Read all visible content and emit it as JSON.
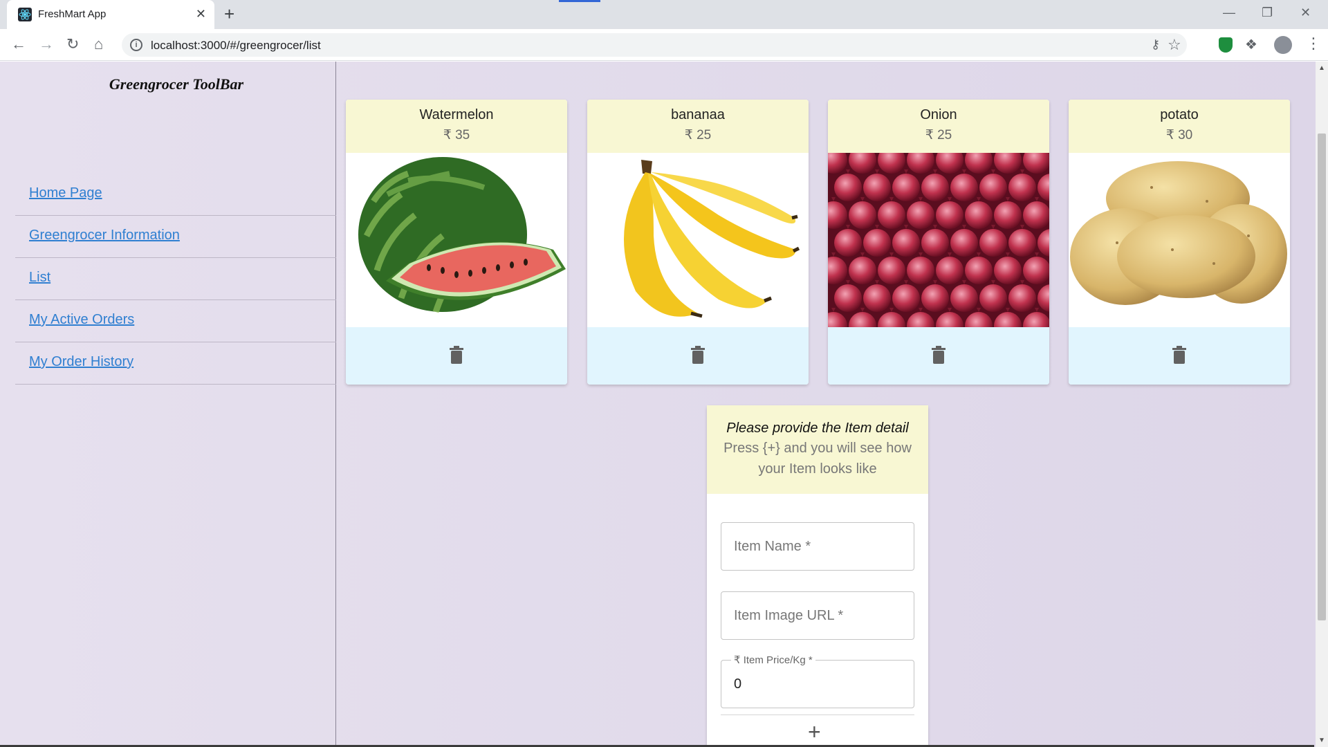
{
  "browser": {
    "tab_title": "FreshMart App",
    "tab_close": "✕",
    "new_tab": "+",
    "url": "localhost:3000/#/greengrocer/list"
  },
  "sidebar": {
    "title": "Greengrocer ToolBar",
    "items": [
      {
        "label": "Home Page"
      },
      {
        "label": "Greengrocer Information"
      },
      {
        "label": "List"
      },
      {
        "label": "My Active Orders"
      },
      {
        "label": "My Order History"
      }
    ]
  },
  "products": [
    {
      "name": "Watermelon",
      "price": "₹ 35",
      "image": "watermelon"
    },
    {
      "name": "bananaa",
      "price": "₹ 25",
      "image": "banana"
    },
    {
      "name": "Onion",
      "price": "₹ 25",
      "image": "onion"
    },
    {
      "name": "potato",
      "price": "₹ 30",
      "image": "potato"
    }
  ],
  "form": {
    "heading": "Please provide the Item detail",
    "subtext": "Press {+} and you will see how your Item looks like",
    "name_placeholder": "Item Name *",
    "image_placeholder": "Item Image URL *",
    "price_label": "₹ Item Price/Kg *",
    "price_value": "0",
    "add_label": "+"
  },
  "colors": {
    "card_header": "#f8f7d3",
    "card_footer": "#e1f5fe",
    "link": "#2f7fd1",
    "background": "#e2dcec"
  },
  "icons": [
    "react-favicon-icon",
    "back-arrow-icon",
    "forward-arrow-icon",
    "reload-icon",
    "home-icon",
    "info-icon",
    "key-icon",
    "star-icon",
    "shield-extension-icon",
    "puzzle-icon",
    "profile-avatar",
    "menu-dots-icon",
    "trash-icon",
    "plus-icon"
  ]
}
